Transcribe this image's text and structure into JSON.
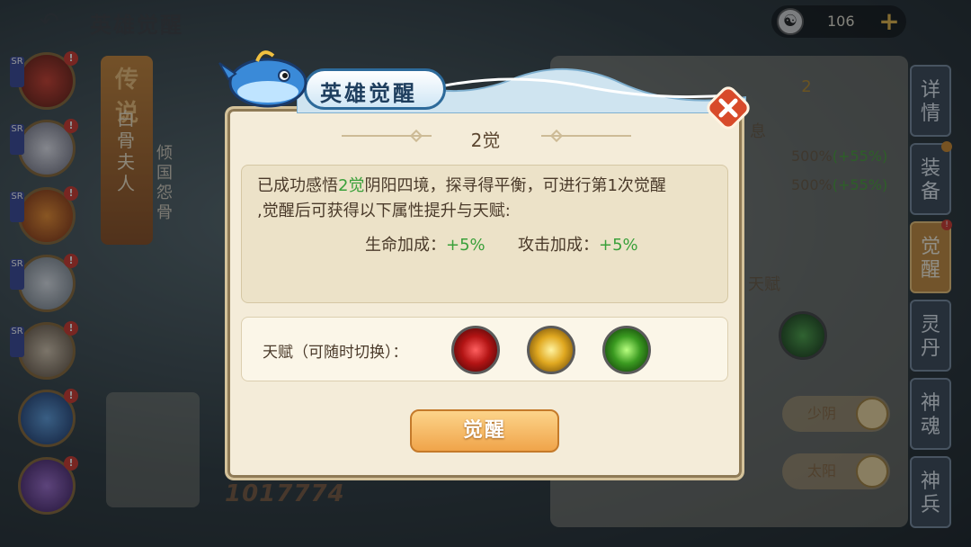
{
  "topbar": {
    "title": "英雄觉醒",
    "currency_value": "106",
    "currency_icon": "yin-yang-icon",
    "plus_label": "+"
  },
  "heroes": [
    {
      "tag": "SR",
      "badge": "!"
    },
    {
      "tag": "SR",
      "badge": "!"
    },
    {
      "tag": "SR",
      "badge": "!"
    },
    {
      "tag": "SR",
      "badge": "!"
    },
    {
      "tag": "SR",
      "badge": "!"
    },
    {
      "tag": "",
      "badge": "!"
    },
    {
      "tag": "",
      "badge": "!"
    }
  ],
  "hero_info": {
    "rarity_mark": "传说",
    "name_vertical": "白骨夫人",
    "title_vertical": "倾国怨骨",
    "power": "1017774"
  },
  "right_panel": {
    "info_label": "息",
    "stats": [
      {
        "value": "500%",
        "inc": "(+55%)"
      },
      {
        "value": "500%",
        "inc": "(+55%)"
      }
    ],
    "talent_label": "天赋",
    "buttons": [
      "少阴",
      "太阳"
    ],
    "badge": "2"
  },
  "side_tabs": [
    {
      "label": "详情",
      "dot": false
    },
    {
      "label": "装备",
      "dot": true
    },
    {
      "label": "觉醒",
      "dot": true,
      "active": true
    },
    {
      "label": "灵丹",
      "dot": false
    },
    {
      "label": "神魂",
      "dot": false
    },
    {
      "label": "神兵",
      "dot": false
    }
  ],
  "dialog": {
    "title": "英雄觉醒",
    "subtitle": "2觉",
    "desc_part1": "已成功感悟",
    "desc_highlight": "2觉",
    "desc_part2": "阴阳四境，探寻得平衡，可进行第1次觉醒",
    "desc_line2": ",觉醒后可获得以下属性提升与天赋:",
    "bonuses": [
      {
        "label": "生命加成：",
        "value": "+5%"
      },
      {
        "label": "攻击加成：",
        "value": "+5%"
      }
    ],
    "talent_label": "天赋（可随时切换）：",
    "talents": [
      "red-heart-talent-icon",
      "gold-shield-talent-icon",
      "green-paw-talent-icon"
    ],
    "awaken_button": "觉醒"
  },
  "colors": {
    "highlight": "#3aa03a",
    "button_orange": "#f0a44a",
    "dialog_bg": "#f4ecd9"
  }
}
